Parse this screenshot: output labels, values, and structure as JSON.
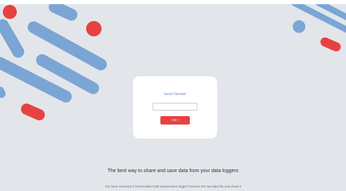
{
  "form": {
    "serial_label": "Serial Number",
    "serial_value": "",
    "go_label": "GO !"
  },
  "footer": {
    "tagline": "The best way to share and save data from your data loggers",
    "subtext": "You have received a Thermolabo USB temperature logger? Extract the raw data file and share it"
  },
  "colors": {
    "background": "#e2e6ea",
    "stripe_blue": "#7ba5d5",
    "accent_red": "#e84142",
    "card": "#ffffff"
  }
}
